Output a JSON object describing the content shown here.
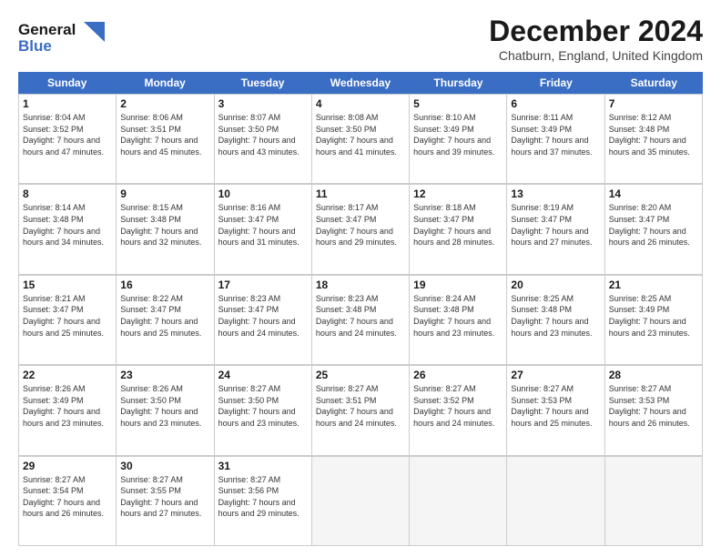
{
  "header": {
    "logo_line1": "General",
    "logo_line2": "Blue",
    "month_title": "December 2024",
    "location": "Chatburn, England, United Kingdom"
  },
  "weekdays": [
    "Sunday",
    "Monday",
    "Tuesday",
    "Wednesday",
    "Thursday",
    "Friday",
    "Saturday"
  ],
  "weeks": [
    [
      {
        "day": "1",
        "sunrise": "8:04 AM",
        "sunset": "3:52 PM",
        "daylight": "7 hours and 47 minutes."
      },
      {
        "day": "2",
        "sunrise": "8:06 AM",
        "sunset": "3:51 PM",
        "daylight": "7 hours and 45 minutes."
      },
      {
        "day": "3",
        "sunrise": "8:07 AM",
        "sunset": "3:50 PM",
        "daylight": "7 hours and 43 minutes."
      },
      {
        "day": "4",
        "sunrise": "8:08 AM",
        "sunset": "3:50 PM",
        "daylight": "7 hours and 41 minutes."
      },
      {
        "day": "5",
        "sunrise": "8:10 AM",
        "sunset": "3:49 PM",
        "daylight": "7 hours and 39 minutes."
      },
      {
        "day": "6",
        "sunrise": "8:11 AM",
        "sunset": "3:49 PM",
        "daylight": "7 hours and 37 minutes."
      },
      {
        "day": "7",
        "sunrise": "8:12 AM",
        "sunset": "3:48 PM",
        "daylight": "7 hours and 35 minutes."
      }
    ],
    [
      {
        "day": "8",
        "sunrise": "8:14 AM",
        "sunset": "3:48 PM",
        "daylight": "7 hours and 34 minutes."
      },
      {
        "day": "9",
        "sunrise": "8:15 AM",
        "sunset": "3:48 PM",
        "daylight": "7 hours and 32 minutes."
      },
      {
        "day": "10",
        "sunrise": "8:16 AM",
        "sunset": "3:47 PM",
        "daylight": "7 hours and 31 minutes."
      },
      {
        "day": "11",
        "sunrise": "8:17 AM",
        "sunset": "3:47 PM",
        "daylight": "7 hours and 29 minutes."
      },
      {
        "day": "12",
        "sunrise": "8:18 AM",
        "sunset": "3:47 PM",
        "daylight": "7 hours and 28 minutes."
      },
      {
        "day": "13",
        "sunrise": "8:19 AM",
        "sunset": "3:47 PM",
        "daylight": "7 hours and 27 minutes."
      },
      {
        "day": "14",
        "sunrise": "8:20 AM",
        "sunset": "3:47 PM",
        "daylight": "7 hours and 26 minutes."
      }
    ],
    [
      {
        "day": "15",
        "sunrise": "8:21 AM",
        "sunset": "3:47 PM",
        "daylight": "7 hours and 25 minutes."
      },
      {
        "day": "16",
        "sunrise": "8:22 AM",
        "sunset": "3:47 PM",
        "daylight": "7 hours and 25 minutes."
      },
      {
        "day": "17",
        "sunrise": "8:23 AM",
        "sunset": "3:47 PM",
        "daylight": "7 hours and 24 minutes."
      },
      {
        "day": "18",
        "sunrise": "8:23 AM",
        "sunset": "3:48 PM",
        "daylight": "7 hours and 24 minutes."
      },
      {
        "day": "19",
        "sunrise": "8:24 AM",
        "sunset": "3:48 PM",
        "daylight": "7 hours and 23 minutes."
      },
      {
        "day": "20",
        "sunrise": "8:25 AM",
        "sunset": "3:48 PM",
        "daylight": "7 hours and 23 minutes."
      },
      {
        "day": "21",
        "sunrise": "8:25 AM",
        "sunset": "3:49 PM",
        "daylight": "7 hours and 23 minutes."
      }
    ],
    [
      {
        "day": "22",
        "sunrise": "8:26 AM",
        "sunset": "3:49 PM",
        "daylight": "7 hours and 23 minutes."
      },
      {
        "day": "23",
        "sunrise": "8:26 AM",
        "sunset": "3:50 PM",
        "daylight": "7 hours and 23 minutes."
      },
      {
        "day": "24",
        "sunrise": "8:27 AM",
        "sunset": "3:50 PM",
        "daylight": "7 hours and 23 minutes."
      },
      {
        "day": "25",
        "sunrise": "8:27 AM",
        "sunset": "3:51 PM",
        "daylight": "7 hours and 24 minutes."
      },
      {
        "day": "26",
        "sunrise": "8:27 AM",
        "sunset": "3:52 PM",
        "daylight": "7 hours and 24 minutes."
      },
      {
        "day": "27",
        "sunrise": "8:27 AM",
        "sunset": "3:53 PM",
        "daylight": "7 hours and 25 minutes."
      },
      {
        "day": "28",
        "sunrise": "8:27 AM",
        "sunset": "3:53 PM",
        "daylight": "7 hours and 26 minutes."
      }
    ],
    [
      {
        "day": "29",
        "sunrise": "8:27 AM",
        "sunset": "3:54 PM",
        "daylight": "7 hours and 26 minutes."
      },
      {
        "day": "30",
        "sunrise": "8:27 AM",
        "sunset": "3:55 PM",
        "daylight": "7 hours and 27 minutes."
      },
      {
        "day": "31",
        "sunrise": "8:27 AM",
        "sunset": "3:56 PM",
        "daylight": "7 hours and 29 minutes."
      },
      null,
      null,
      null,
      null
    ]
  ]
}
